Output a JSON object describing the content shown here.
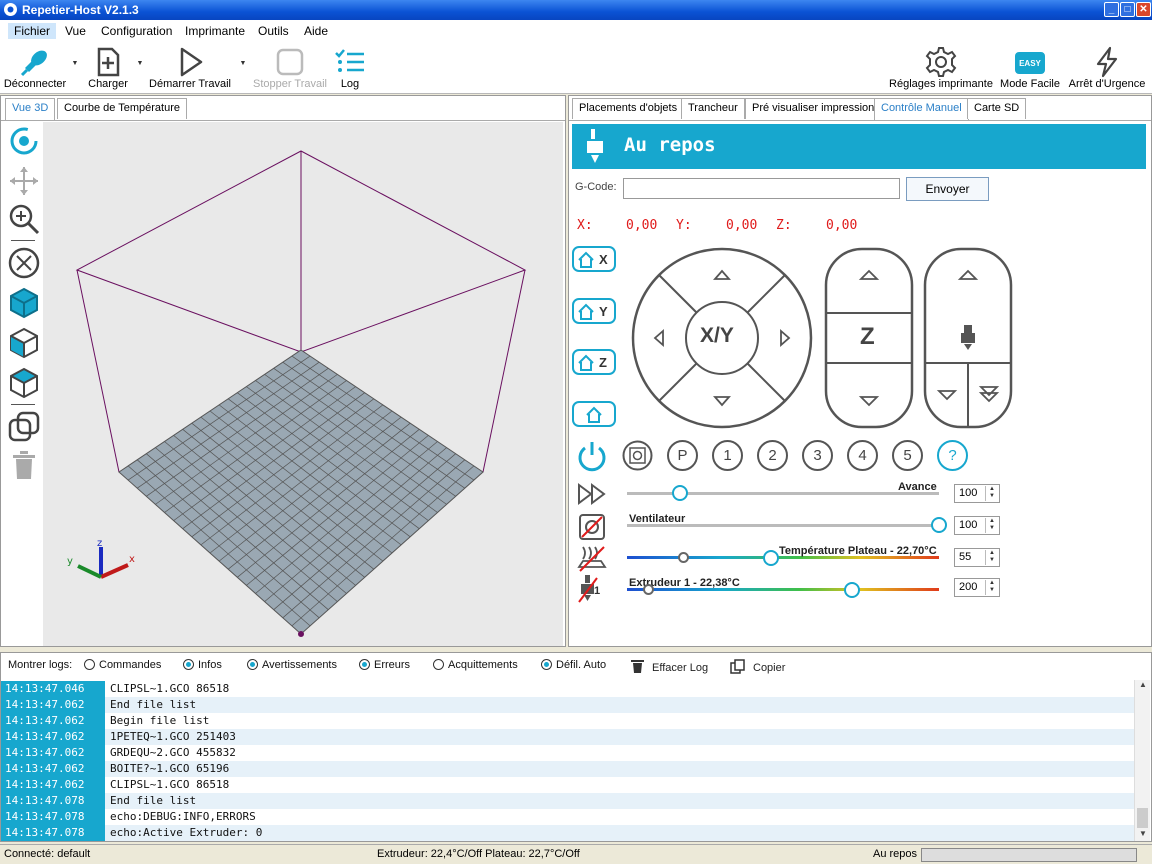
{
  "window": {
    "title": "Repetier-Host V2.1.3"
  },
  "menu": [
    "Fichier",
    "Vue",
    "Configuration",
    "Imprimante",
    "Outils",
    "Aide"
  ],
  "toolbar": {
    "disconnect": "Déconnecter",
    "load": "Charger",
    "start_job": "Démarrer Travail",
    "stop_job": "Stopper Travail",
    "log": "Log",
    "printer_settings": "Réglages imprimante",
    "easy_mode": "Mode Facile",
    "easy_badge": "EASY",
    "emergency_stop": "Arrêt d'Urgence"
  },
  "left_tabs": [
    "Vue 3D",
    "Courbe de Température"
  ],
  "right_tabs": [
    "Placements d'objets",
    "Trancheur",
    "Pré visualiser impression",
    "Contrôle Manuel",
    "Carte SD"
  ],
  "manual": {
    "state": "Au repos",
    "gcode_label": "G-Code:",
    "gcode_value": "",
    "send": "Envoyer",
    "coords": {
      "x_label": "X:",
      "x": "0,00",
      "y_label": "Y:",
      "y": "0,00",
      "z_label": "Z:",
      "z": "0,00"
    },
    "home_buttons": [
      "X",
      "Y",
      "Z",
      ""
    ],
    "jog": {
      "xy": "X/Y",
      "z": "Z"
    },
    "preset_buttons": [
      "P",
      "1",
      "2",
      "3",
      "4",
      "5",
      "?"
    ],
    "sliders": {
      "feed": {
        "label": "Avance",
        "value": "100",
        "fraction": 0.17
      },
      "fan": {
        "label": "Ventilateur",
        "value": "100",
        "fraction": 1.0
      },
      "bed": {
        "label": "Température Plateau - 22,70°C",
        "value": "55",
        "actual_fraction": 0.18,
        "target_fraction": 0.46
      },
      "extruder": {
        "label": "Extrudeur 1 - 22,38°C",
        "value": "200",
        "actual_fraction": 0.07,
        "target_fraction": 0.72,
        "index": "1"
      }
    }
  },
  "log": {
    "show_label": "Montrer logs:",
    "filters": [
      {
        "label": "Commandes",
        "on": false
      },
      {
        "label": "Infos",
        "on": true
      },
      {
        "label": "Avertissements",
        "on": true
      },
      {
        "label": "Erreurs",
        "on": true
      },
      {
        "label": "Acquittements",
        "on": false
      },
      {
        "label": "Défil. Auto",
        "on": true
      }
    ],
    "clear": "Effacer Log",
    "copy": "Copier",
    "rows": [
      {
        "time": "14:13:47.046",
        "msg": "CLIPSL~1.GCO 86518"
      },
      {
        "time": "14:13:47.062",
        "msg": "End file list"
      },
      {
        "time": "14:13:47.062",
        "msg": "Begin file list"
      },
      {
        "time": "14:13:47.062",
        "msg": "1PETEQ~1.GCO 251403"
      },
      {
        "time": "14:13:47.062",
        "msg": "GRDEQU~2.GCO 455832"
      },
      {
        "time": "14:13:47.062",
        "msg": "BOITE?~1.GCO 65196"
      },
      {
        "time": "14:13:47.062",
        "msg": "CLIPSL~1.GCO 86518"
      },
      {
        "time": "14:13:47.078",
        "msg": "End file list"
      },
      {
        "time": "14:13:47.078",
        "msg": "echo:DEBUG:INFO,ERRORS"
      },
      {
        "time": "14:13:47.078",
        "msg": "echo:Active Extruder: 0"
      }
    ]
  },
  "status": {
    "connection": "Connecté: default",
    "temps": "Extrudeur: 22,4°C/Off Plateau: 22,7°C/Off",
    "state": "Au repos"
  },
  "colors": {
    "accent": "#17a7ce",
    "coords": "#e01b1b",
    "box": "#6a1060",
    "bed": "#9aa8b3"
  }
}
